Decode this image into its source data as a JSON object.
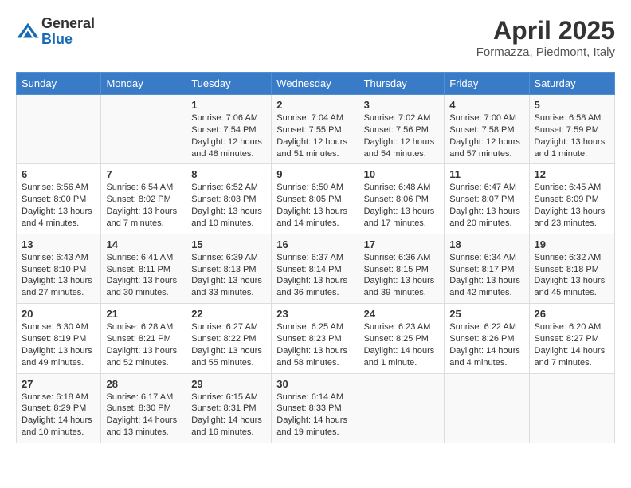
{
  "logo": {
    "general": "General",
    "blue": "Blue"
  },
  "title": "April 2025",
  "subtitle": "Formazza, Piedmont, Italy",
  "days_of_week": [
    "Sunday",
    "Monday",
    "Tuesday",
    "Wednesday",
    "Thursday",
    "Friday",
    "Saturday"
  ],
  "weeks": [
    [
      {
        "day": "",
        "info": ""
      },
      {
        "day": "",
        "info": ""
      },
      {
        "day": "1",
        "info": "Sunrise: 7:06 AM\nSunset: 7:54 PM\nDaylight: 12 hours and 48 minutes."
      },
      {
        "day": "2",
        "info": "Sunrise: 7:04 AM\nSunset: 7:55 PM\nDaylight: 12 hours and 51 minutes."
      },
      {
        "day": "3",
        "info": "Sunrise: 7:02 AM\nSunset: 7:56 PM\nDaylight: 12 hours and 54 minutes."
      },
      {
        "day": "4",
        "info": "Sunrise: 7:00 AM\nSunset: 7:58 PM\nDaylight: 12 hours and 57 minutes."
      },
      {
        "day": "5",
        "info": "Sunrise: 6:58 AM\nSunset: 7:59 PM\nDaylight: 13 hours and 1 minute."
      }
    ],
    [
      {
        "day": "6",
        "info": "Sunrise: 6:56 AM\nSunset: 8:00 PM\nDaylight: 13 hours and 4 minutes."
      },
      {
        "day": "7",
        "info": "Sunrise: 6:54 AM\nSunset: 8:02 PM\nDaylight: 13 hours and 7 minutes."
      },
      {
        "day": "8",
        "info": "Sunrise: 6:52 AM\nSunset: 8:03 PM\nDaylight: 13 hours and 10 minutes."
      },
      {
        "day": "9",
        "info": "Sunrise: 6:50 AM\nSunset: 8:05 PM\nDaylight: 13 hours and 14 minutes."
      },
      {
        "day": "10",
        "info": "Sunrise: 6:48 AM\nSunset: 8:06 PM\nDaylight: 13 hours and 17 minutes."
      },
      {
        "day": "11",
        "info": "Sunrise: 6:47 AM\nSunset: 8:07 PM\nDaylight: 13 hours and 20 minutes."
      },
      {
        "day": "12",
        "info": "Sunrise: 6:45 AM\nSunset: 8:09 PM\nDaylight: 13 hours and 23 minutes."
      }
    ],
    [
      {
        "day": "13",
        "info": "Sunrise: 6:43 AM\nSunset: 8:10 PM\nDaylight: 13 hours and 27 minutes."
      },
      {
        "day": "14",
        "info": "Sunrise: 6:41 AM\nSunset: 8:11 PM\nDaylight: 13 hours and 30 minutes."
      },
      {
        "day": "15",
        "info": "Sunrise: 6:39 AM\nSunset: 8:13 PM\nDaylight: 13 hours and 33 minutes."
      },
      {
        "day": "16",
        "info": "Sunrise: 6:37 AM\nSunset: 8:14 PM\nDaylight: 13 hours and 36 minutes."
      },
      {
        "day": "17",
        "info": "Sunrise: 6:36 AM\nSunset: 8:15 PM\nDaylight: 13 hours and 39 minutes."
      },
      {
        "day": "18",
        "info": "Sunrise: 6:34 AM\nSunset: 8:17 PM\nDaylight: 13 hours and 42 minutes."
      },
      {
        "day": "19",
        "info": "Sunrise: 6:32 AM\nSunset: 8:18 PM\nDaylight: 13 hours and 45 minutes."
      }
    ],
    [
      {
        "day": "20",
        "info": "Sunrise: 6:30 AM\nSunset: 8:19 PM\nDaylight: 13 hours and 49 minutes."
      },
      {
        "day": "21",
        "info": "Sunrise: 6:28 AM\nSunset: 8:21 PM\nDaylight: 13 hours and 52 minutes."
      },
      {
        "day": "22",
        "info": "Sunrise: 6:27 AM\nSunset: 8:22 PM\nDaylight: 13 hours and 55 minutes."
      },
      {
        "day": "23",
        "info": "Sunrise: 6:25 AM\nSunset: 8:23 PM\nDaylight: 13 hours and 58 minutes."
      },
      {
        "day": "24",
        "info": "Sunrise: 6:23 AM\nSunset: 8:25 PM\nDaylight: 14 hours and 1 minute."
      },
      {
        "day": "25",
        "info": "Sunrise: 6:22 AM\nSunset: 8:26 PM\nDaylight: 14 hours and 4 minutes."
      },
      {
        "day": "26",
        "info": "Sunrise: 6:20 AM\nSunset: 8:27 PM\nDaylight: 14 hours and 7 minutes."
      }
    ],
    [
      {
        "day": "27",
        "info": "Sunrise: 6:18 AM\nSunset: 8:29 PM\nDaylight: 14 hours and 10 minutes."
      },
      {
        "day": "28",
        "info": "Sunrise: 6:17 AM\nSunset: 8:30 PM\nDaylight: 14 hours and 13 minutes."
      },
      {
        "day": "29",
        "info": "Sunrise: 6:15 AM\nSunset: 8:31 PM\nDaylight: 14 hours and 16 minutes."
      },
      {
        "day": "30",
        "info": "Sunrise: 6:14 AM\nSunset: 8:33 PM\nDaylight: 14 hours and 19 minutes."
      },
      {
        "day": "",
        "info": ""
      },
      {
        "day": "",
        "info": ""
      },
      {
        "day": "",
        "info": ""
      }
    ]
  ]
}
